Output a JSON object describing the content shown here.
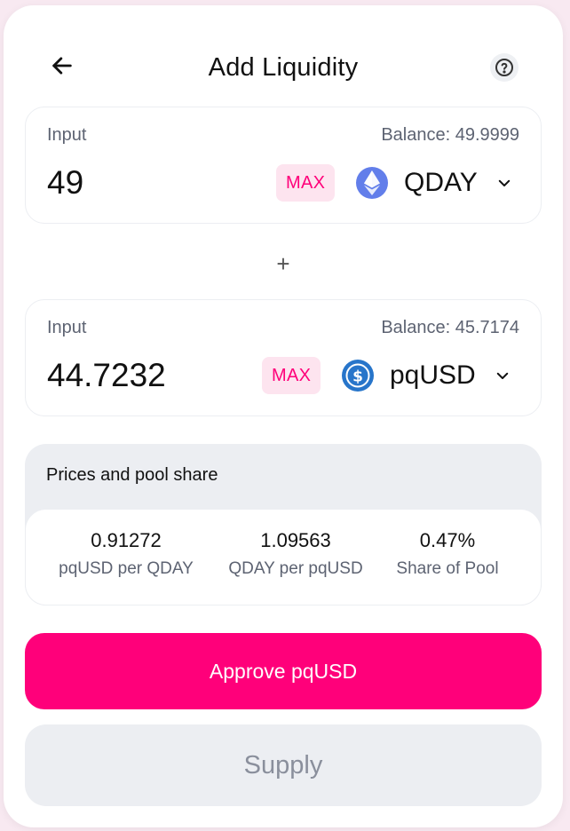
{
  "header": {
    "title": "Add Liquidity"
  },
  "inputs": [
    {
      "label": "Input",
      "balance": "Balance: 49.9999",
      "value": "49",
      "max_label": "MAX",
      "token": "QDAY",
      "token_icon": "ethereum-icon"
    },
    {
      "label": "Input",
      "balance": "Balance: 45.7174",
      "value": "44.7232",
      "max_label": "MAX",
      "token": "pqUSD",
      "token_icon": "usd-coin-icon"
    }
  ],
  "plus_symbol": "+",
  "prices": {
    "heading": "Prices and pool share",
    "items": [
      {
        "value": "0.91272",
        "label": "pqUSD per QDAY"
      },
      {
        "value": "1.09563",
        "label": "QDAY per pqUSD"
      },
      {
        "value": "0.47%",
        "label": "Share of Pool"
      }
    ]
  },
  "actions": {
    "approve_label": "Approve pqUSD",
    "supply_label": "Supply"
  },
  "colors": {
    "accent": "#ff007a",
    "accent_soft": "#fde4ef",
    "ethereum": "#627eea",
    "usdc": "#2775ca",
    "panel_gray": "#eceef2",
    "muted_text": "#5d6372"
  }
}
